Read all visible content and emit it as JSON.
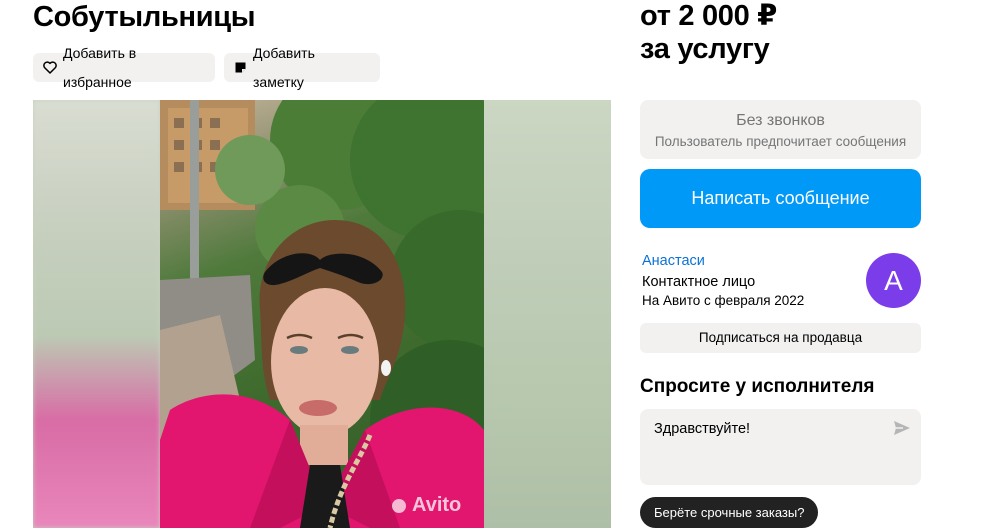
{
  "listing": {
    "title": "Собутыльницы",
    "favorite_label": "Добавить в избранное",
    "note_label": "Добавить заметку",
    "watermark": "Avito"
  },
  "sidebar": {
    "price_line1": "от 2 000 ₽",
    "price_line2": "за услугу",
    "no_calls_title": "Без звонков",
    "no_calls_subtitle": "Пользователь предпочитает сообщения",
    "write_button": "Написать сообщение",
    "seller": {
      "name": "Анастаси",
      "role": "Контактное лицо",
      "since": "На Авито с февраля 2022",
      "avatar_letter": "А"
    },
    "subscribe_button": "Подписаться на продавца",
    "ask_title": "Спросите у исполнителя",
    "message_value": "Здравствуйте!",
    "quick_question": "Берёте срочные заказы?"
  },
  "colors": {
    "accent": "#0099f7",
    "link": "#0a73d6",
    "avatar": "#7b3dea",
    "chip_bg": "#f2f1f0"
  },
  "icons": [
    "heart-icon",
    "note-icon",
    "send-icon"
  ]
}
